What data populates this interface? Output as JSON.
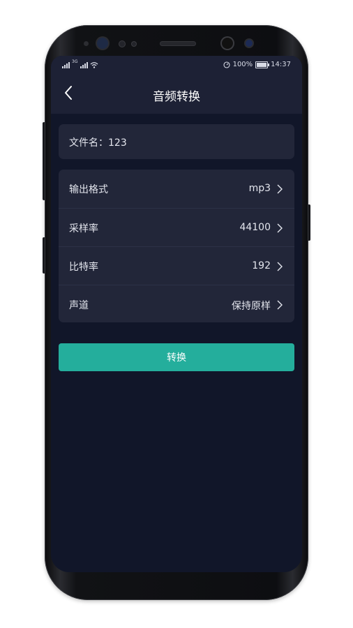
{
  "status_bar": {
    "network_label": "3G",
    "battery_percent": "100%",
    "time": "14:37"
  },
  "header": {
    "title": "音频转换"
  },
  "file": {
    "name_text": "文件名：123"
  },
  "options": [
    {
      "label": "输出格式",
      "value": "mp3"
    },
    {
      "label": "采样率",
      "value": "44100"
    },
    {
      "label": "比特率",
      "value": "192"
    },
    {
      "label": "声道",
      "value": "保持原样"
    }
  ],
  "actions": {
    "convert_label": "转换"
  },
  "colors": {
    "background": "#111629",
    "card": "#222639",
    "header": "#1d2135",
    "accent": "#24ae9c",
    "text": "#e4e6ee"
  },
  "icons": [
    "back-arrow-icon",
    "chevron-right-icon",
    "signal-icon",
    "wifi-icon",
    "clock-icon",
    "battery-icon"
  ]
}
